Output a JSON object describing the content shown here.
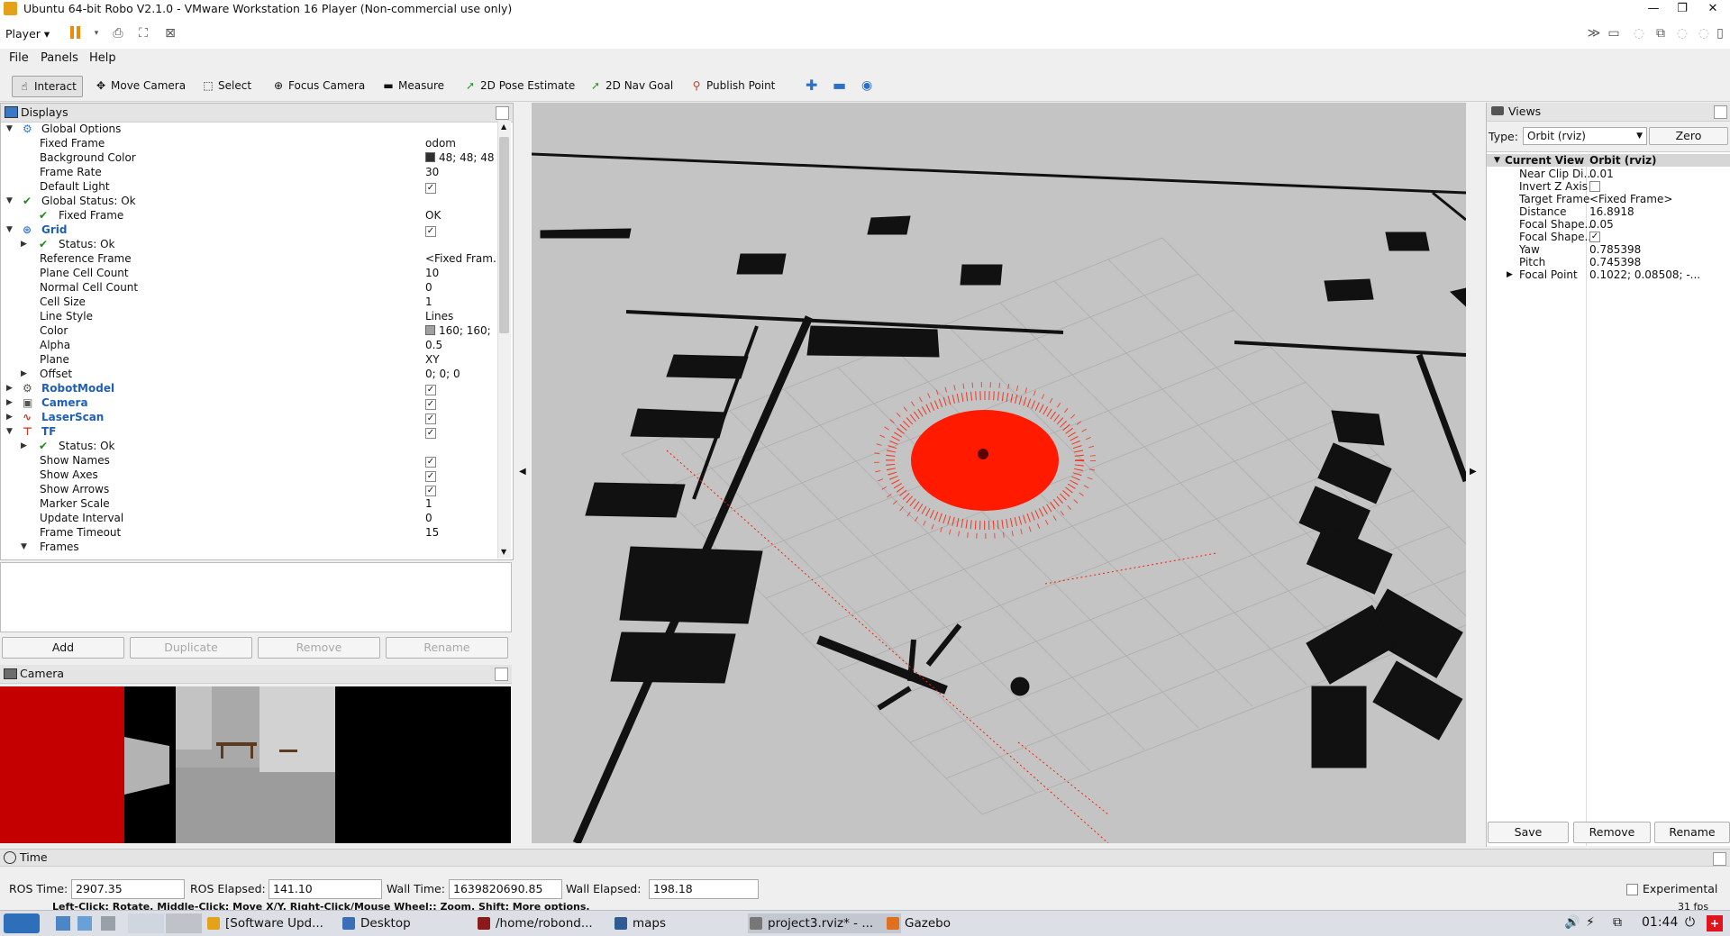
{
  "window": {
    "title": "Ubuntu 64-bit Robo V2.1.0 - VMware Workstation 16 Player (Non-commercial use only)",
    "player_label": "Player"
  },
  "menu": {
    "file": "File",
    "panels": "Panels",
    "help": "Help"
  },
  "toolbar": {
    "interact": "Interact",
    "move_camera": "Move Camera",
    "select": "Select",
    "focus_camera": "Focus Camera",
    "measure": "Measure",
    "pose_estimate": "2D Pose Estimate",
    "nav_goal": "2D Nav Goal",
    "publish_point": "Publish Point"
  },
  "displays": {
    "title": "Displays",
    "rows": [
      {
        "label": "Global Options",
        "value": "",
        "indent": 1,
        "arrow": "down",
        "icon": "gear"
      },
      {
        "label": "Fixed Frame",
        "value": "odom",
        "indent": 2
      },
      {
        "label": "Background Color",
        "value": "48; 48; 48",
        "indent": 2,
        "swatch": "#303030"
      },
      {
        "label": "Frame Rate",
        "value": "30",
        "indent": 2
      },
      {
        "label": "Default Light",
        "value": "",
        "indent": 2,
        "checked": true
      },
      {
        "label": "Global Status: Ok",
        "value": "",
        "indent": 1,
        "arrow": "down",
        "icon": "ok"
      },
      {
        "label": "Fixed Frame",
        "value": "OK",
        "indent": 2,
        "icon": "ok"
      },
      {
        "label": "Grid",
        "value": "",
        "indent": 1,
        "arrow": "down",
        "icon": "grid",
        "bold": true,
        "checked": true
      },
      {
        "label": "Status: Ok",
        "value": "",
        "indent": 2,
        "arrow": "right",
        "icon": "ok"
      },
      {
        "label": "Reference Frame",
        "value": "<Fixed Fram...",
        "indent": 2
      },
      {
        "label": "Plane Cell Count",
        "value": "10",
        "indent": 2
      },
      {
        "label": "Normal Cell Count",
        "value": "0",
        "indent": 2
      },
      {
        "label": "Cell Size",
        "value": "1",
        "indent": 2
      },
      {
        "label": "Line Style",
        "value": "Lines",
        "indent": 2
      },
      {
        "label": "Color",
        "value": "160; 160;",
        "indent": 2,
        "swatch": "#a0a0a0"
      },
      {
        "label": "Alpha",
        "value": "0.5",
        "indent": 2
      },
      {
        "label": "Plane",
        "value": "XY",
        "indent": 2
      },
      {
        "label": "Offset",
        "value": "0; 0; 0",
        "indent": 2,
        "arrow": "right"
      },
      {
        "label": "RobotModel",
        "value": "",
        "indent": 1,
        "arrow": "right",
        "icon": "robot",
        "bold": true,
        "checked": true
      },
      {
        "label": "Camera",
        "value": "",
        "indent": 1,
        "arrow": "right",
        "icon": "camera",
        "bold": true,
        "checked": true
      },
      {
        "label": "LaserScan",
        "value": "",
        "indent": 1,
        "arrow": "right",
        "icon": "laser",
        "bold": true,
        "checked": true
      },
      {
        "label": "TF",
        "value": "",
        "indent": 1,
        "arrow": "down",
        "icon": "tf",
        "bold": true,
        "checked": true
      },
      {
        "label": "Status: Ok",
        "value": "",
        "indent": 2,
        "arrow": "right",
        "icon": "ok"
      },
      {
        "label": "Show Names",
        "value": "",
        "indent": 2,
        "checked": true
      },
      {
        "label": "Show Axes",
        "value": "",
        "indent": 2,
        "checked": true
      },
      {
        "label": "Show Arrows",
        "value": "",
        "indent": 2,
        "checked": true
      },
      {
        "label": "Marker Scale",
        "value": "1",
        "indent": 2
      },
      {
        "label": "Update Interval",
        "value": "0",
        "indent": 2
      },
      {
        "label": "Frame Timeout",
        "value": "15",
        "indent": 2
      },
      {
        "label": "Frames",
        "value": "",
        "indent": 2,
        "arrow": "down"
      }
    ],
    "buttons": {
      "add": "Add",
      "duplicate": "Duplicate",
      "remove": "Remove",
      "rename": "Rename"
    }
  },
  "camera_panel": {
    "title": "Camera"
  },
  "views": {
    "title": "Views",
    "type_label": "Type:",
    "type_value": "Orbit (rviz)",
    "zero": "Zero",
    "current_view": "Current View",
    "current_view_value": "Orbit (rviz)",
    "rows": [
      {
        "label": "Near Clip Di...",
        "value": "0.01"
      },
      {
        "label": "Invert Z Axis",
        "value": "",
        "checkbox": true,
        "checked": false
      },
      {
        "label": "Target Frame",
        "value": "<Fixed Frame>"
      },
      {
        "label": "Distance",
        "value": "16.8918"
      },
      {
        "label": "Focal Shape...",
        "value": "0.05"
      },
      {
        "label": "Focal Shape...",
        "value": "",
        "checkbox": true,
        "checked": true
      },
      {
        "label": "Yaw",
        "value": "0.785398"
      },
      {
        "label": "Pitch",
        "value": "0.745398"
      },
      {
        "label": "Focal Point",
        "value": "0.1022; 0.08508; -...",
        "arrow": true
      }
    ],
    "buttons": {
      "save": "Save",
      "remove": "Remove",
      "rename": "Rename"
    }
  },
  "time": {
    "title": "Time",
    "ros_time_label": "ROS Time:",
    "ros_time": "2907.35",
    "ros_elapsed_label": "ROS Elapsed:",
    "ros_elapsed": "141.10",
    "wall_time_label": "Wall Time:",
    "wall_time": "1639820690.85",
    "wall_elapsed_label": "Wall Elapsed:",
    "wall_elapsed": "198.18",
    "experimental": "Experimental"
  },
  "status": {
    "hint": "Left-Click: Rotate. Middle-Click: Move X/Y. Right-Click/Mouse Wheel:: Zoom. Shift: More options.",
    "fps": "31 fps"
  },
  "taskbar": {
    "items": [
      "[Software Upd...",
      "Desktop",
      "/home/robond...",
      "maps",
      "project3.rviz* - ...",
      "Gazebo"
    ],
    "clock": "01:44"
  },
  "colors": {
    "accent": "#1f5fb4",
    "pose_array": "#ff1a00",
    "obstacle": "#111111",
    "floor": "#c4c4c4"
  }
}
